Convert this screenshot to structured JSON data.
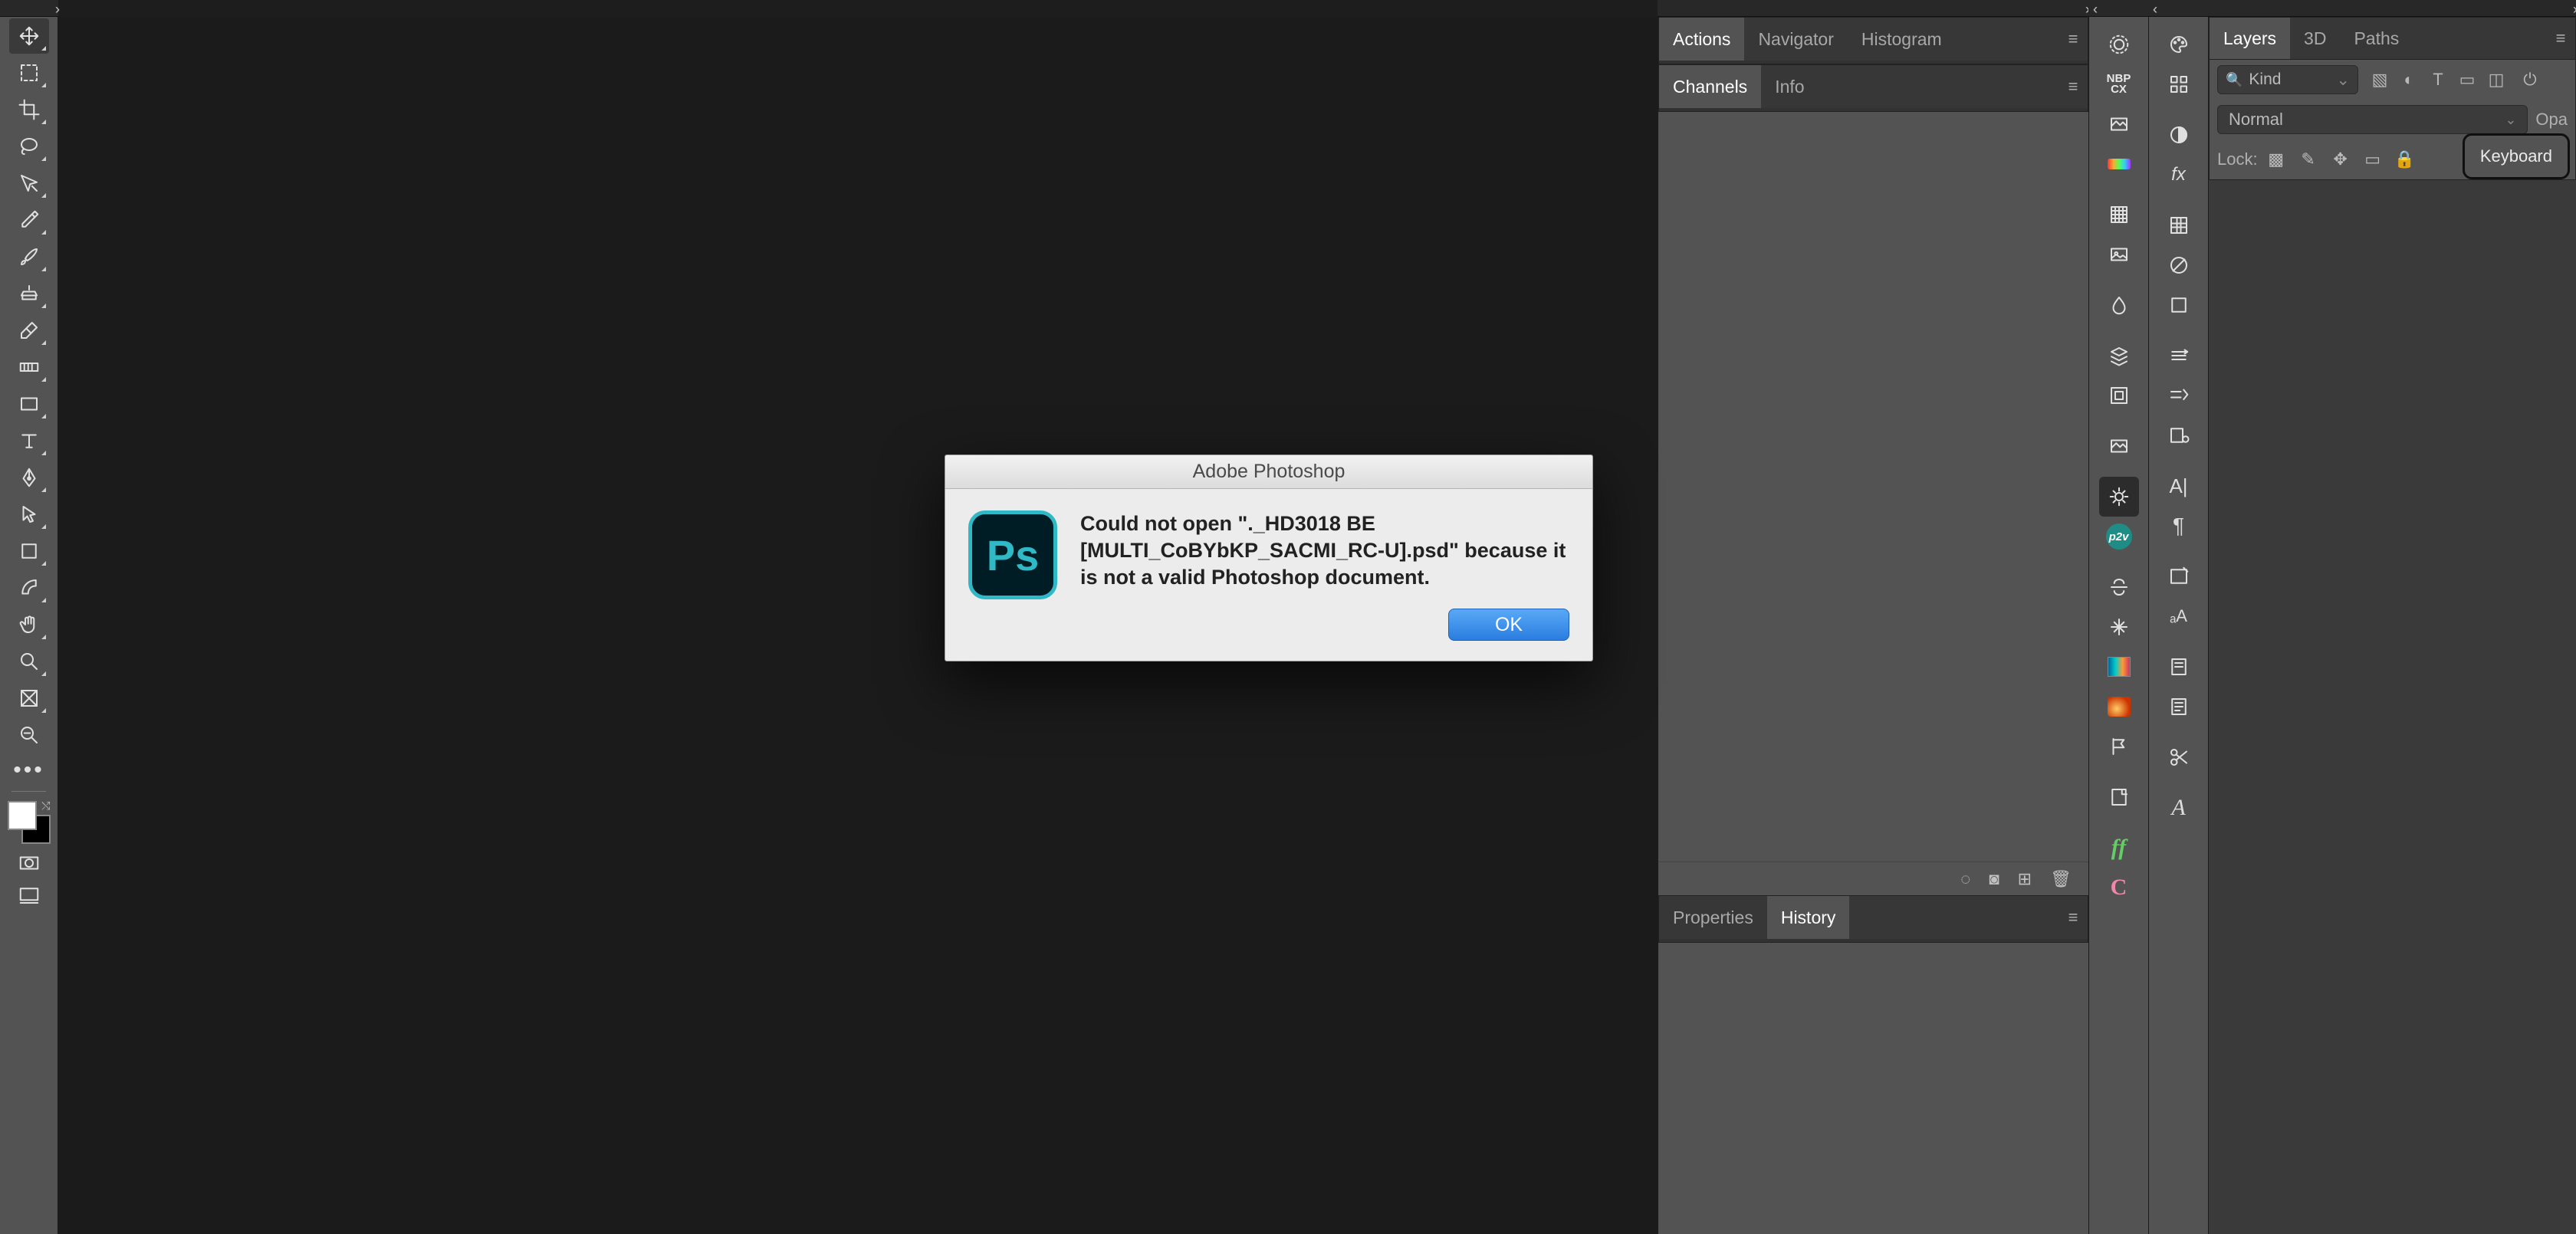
{
  "app": {
    "name": "Adobe Photoshop"
  },
  "panels": {
    "group1a": {
      "tabs": [
        {
          "label": "Actions",
          "active": true
        },
        {
          "label": "Navigator",
          "active": false
        },
        {
          "label": "Histogram",
          "active": false
        }
      ]
    },
    "group1b": {
      "tabs": [
        {
          "label": "Channels",
          "active": true
        },
        {
          "label": "Info",
          "active": false
        }
      ]
    },
    "group1c": {
      "tabs": [
        {
          "label": "Properties",
          "active": false
        },
        {
          "label": "History",
          "active": true
        }
      ]
    },
    "layers": {
      "tabs": [
        {
          "label": "Layers",
          "active": true
        },
        {
          "label": "3D",
          "active": false
        },
        {
          "label": "Paths",
          "active": false
        }
      ],
      "kind_label": "Kind",
      "blend_mode": "Normal",
      "opacity_label": "Opa",
      "lock_label": "Lock:"
    }
  },
  "tooltip": {
    "text": "Keyboard"
  },
  "dialog": {
    "title": "Adobe Photoshop",
    "message": "Could not open \"._HD3018 BE [MULTI_CoBYbKP_SACMI_RC-U].psd\" because it is not a valid Photoshop document.",
    "ok_label": "OK",
    "icon_text": "Ps"
  },
  "tools": [
    "move",
    "marquee",
    "crop",
    "lasso",
    "quick-selection",
    "eyedropper",
    "brush",
    "clone-stamp",
    "eraser",
    "gradient",
    "rectangle-shape",
    "type",
    "pen",
    "path-selection",
    "artboard",
    "custom-pen",
    "hand",
    "zoom",
    "frame",
    "edit-toolbar"
  ]
}
